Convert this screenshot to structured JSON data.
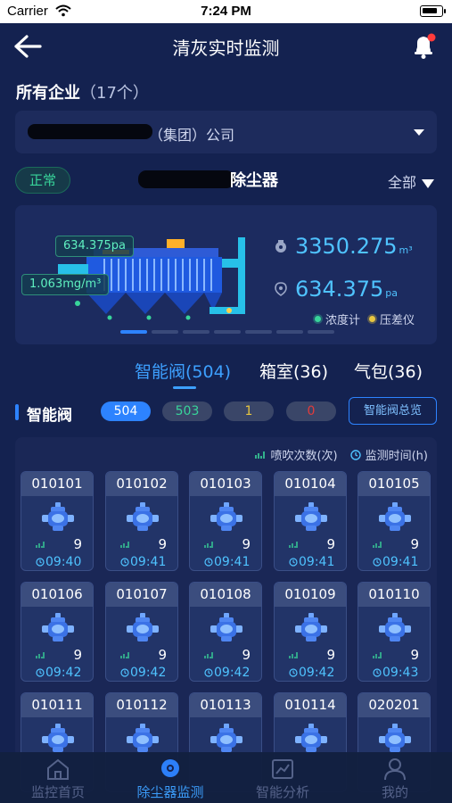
{
  "status_bar": {
    "carrier": "Carrier",
    "time": "7:24 PM"
  },
  "header": {
    "title": "清灰实时监测"
  },
  "company": {
    "label": "所有企业",
    "count": "（17个）",
    "selected_suffix": "（集团）公司"
  },
  "device": {
    "status": "正常",
    "name_suffix": "除尘器",
    "filter": "全部"
  },
  "hero": {
    "tag_pressure": "634.375pa",
    "tag_concentration": "1.063mg/m³",
    "stat_flow_value": "3350.275",
    "stat_flow_unit": "m³",
    "stat_pressure_value": "634.375",
    "stat_pressure_unit": "pa",
    "legend": [
      {
        "label": "浓度计",
        "color": "#38d49a"
      },
      {
        "label": "压差仪",
        "color": "#e8c640"
      }
    ],
    "pager_pages": 7,
    "pager_active": 0
  },
  "tabs": [
    {
      "label": "智能阀(504)",
      "active": true
    },
    {
      "label": "箱室(36)",
      "active": false
    },
    {
      "label": "气包(36)",
      "active": false
    }
  ],
  "section": {
    "title": "智能阀",
    "counts": [
      "504",
      "503",
      "1",
      "0"
    ],
    "overview_button": "智能阀总览"
  },
  "grid": {
    "legend_count": "喷吹次数(次)",
    "legend_time": "监测时间(h)",
    "cells": [
      {
        "id": "010101",
        "count": "9",
        "time": "09:40"
      },
      {
        "id": "010102",
        "count": "9",
        "time": "09:41"
      },
      {
        "id": "010103",
        "count": "9",
        "time": "09:41"
      },
      {
        "id": "010104",
        "count": "9",
        "time": "09:41"
      },
      {
        "id": "010105",
        "count": "9",
        "time": "09:41"
      },
      {
        "id": "010106",
        "count": "9",
        "time": "09:42"
      },
      {
        "id": "010107",
        "count": "9",
        "time": "09:42"
      },
      {
        "id": "010108",
        "count": "9",
        "time": "09:42"
      },
      {
        "id": "010109",
        "count": "9",
        "time": "09:42"
      },
      {
        "id": "010110",
        "count": "9",
        "time": "09:43"
      },
      {
        "id": "010111",
        "count": "",
        "time": ""
      },
      {
        "id": "010112",
        "count": "",
        "time": ""
      },
      {
        "id": "010113",
        "count": "",
        "time": ""
      },
      {
        "id": "010114",
        "count": "",
        "time": ""
      },
      {
        "id": "020201",
        "count": "",
        "time": ""
      }
    ]
  },
  "bottom_nav": [
    {
      "label": "监控首页",
      "icon": "home-icon",
      "active": false
    },
    {
      "label": "除尘器监测",
      "icon": "monitor-icon",
      "active": true
    },
    {
      "label": "智能分析",
      "icon": "analysis-icon",
      "active": false
    },
    {
      "label": "我的",
      "icon": "profile-icon",
      "active": false
    }
  ],
  "colors": {
    "background": "#142250",
    "accent": "#2d83ff",
    "value": "#4fc3ff",
    "normal": "#38d49a"
  }
}
